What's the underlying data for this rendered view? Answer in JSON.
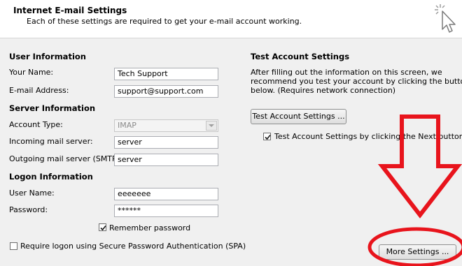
{
  "header": {
    "title": "Internet E-mail Settings",
    "subtitle": "Each of these settings are required to get your e-mail account working."
  },
  "user_info": {
    "heading": "User Information",
    "name_label": "Your Name:",
    "name_value": "Tech Support",
    "email_label": "E-mail Address:",
    "email_value": "support@support.com"
  },
  "server_info": {
    "heading": "Server Information",
    "account_type_label": "Account Type:",
    "account_type_value": "IMAP",
    "incoming_label": "Incoming mail server:",
    "incoming_value": "server",
    "outgoing_label": "Outgoing mail server (SMTP):",
    "outgoing_value": "server"
  },
  "logon_info": {
    "heading": "Logon Information",
    "username_label": "User Name:",
    "username_value": "eeeeeee",
    "password_label": "Password:",
    "password_value": "******",
    "remember_label": "Remember password",
    "remember_checked": true,
    "spa_label": "Require logon using Secure Password Authentication (SPA)",
    "spa_checked": false
  },
  "test_settings": {
    "heading": "Test Account Settings",
    "description_line1": "After filling out the information on this screen, we",
    "description_line2": "recommend you test your account by clicking the button",
    "description_line3": "below. (Requires network connection)",
    "test_button": "Test Account Settings ...",
    "next_check_label": "Test Account Settings by clicking the Next button",
    "next_check_checked": true
  },
  "more_settings_button": "More Settings ...",
  "colors": {
    "annotation_red": "#e8141c",
    "header_bg": "#ffffff",
    "dialog_bg": "#f0f0f0"
  }
}
